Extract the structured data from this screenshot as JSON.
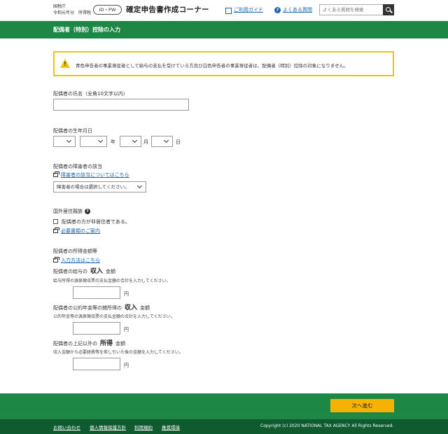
{
  "header": {
    "agency": "国税庁",
    "year": "令和元年分",
    "tax_type": "所得税",
    "id_badge": "ID・PW",
    "corner_title": "確定申告書作成コーナー",
    "guide_link": "ご利用ガイド",
    "faq_link": "よくある質問",
    "search_placeholder": "よくある質問を検索"
  },
  "page_title": "配偶者（特別）控除の入力",
  "warning": "青色申告者の事業専従者として給与の支払を受けている方及び白色申告者の事業専従者は、配偶者（特別）控除の対象になりません。",
  "form": {
    "name_label": "配偶者の氏名（全角10文字以内）",
    "name_value": "",
    "birth_label": "配偶者の生年月日",
    "birth_era": "",
    "birth_year": "",
    "birth_month": "",
    "birth_day": "",
    "year_unit": "年",
    "month_unit": "月",
    "day_unit": "日",
    "disability_label": "配偶者の障害者の該当",
    "disability_link": "障害者の該当についてはこちら",
    "disability_select": "障害者の場合は選択してください。",
    "nonresident_label": "国外居住親族",
    "nonresident_check": "配偶者の方が非居住者である。",
    "required_docs_link": "必要書類のご案内",
    "income_label": "配偶者の所得金額等",
    "input_method_link": "入力方法はこちら",
    "salary_pre": "配偶者の給与の",
    "salary_emph": "収入",
    "salary_post": "金額",
    "salary_help": "給与所得の源泉徴収票の支払金額の合計を入力してください。",
    "pension_pre": "配偶者の公的年金等の雑所得の",
    "pension_emph": "収入",
    "pension_post": "金額",
    "pension_help": "公的年金等の源泉徴収票の支払金額の合計を入力してください。",
    "other_pre": "配偶者の上記以外の",
    "other_emph": "所得",
    "other_post": "金額",
    "other_help": "収入金額から必要経費等を差し引いた後の金額を入力してください。",
    "yen": "円"
  },
  "footer": {
    "next_button": "次へ進む",
    "links": [
      "お問い合わせ",
      "個人情報保護方針",
      "利用規約",
      "推奨環境"
    ],
    "copyright": "Copyright (c) 2020 NATIONAL TAX AGENCY All Rights Reserved."
  },
  "colors": {
    "brand_green": "#1d8746",
    "dark_green": "#0f5a2f",
    "accent": "#f6b200",
    "warning_border": "#f0c400"
  }
}
